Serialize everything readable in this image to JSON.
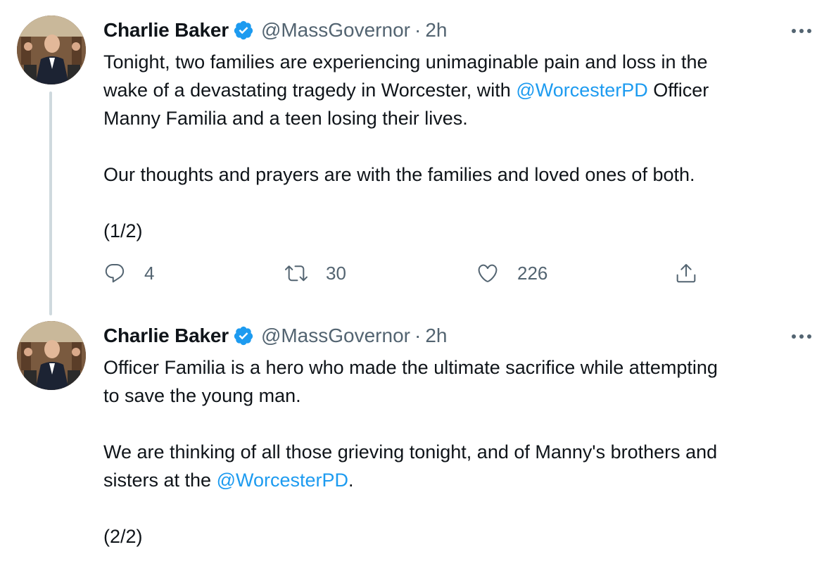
{
  "tweets": [
    {
      "author": {
        "name": "Charlie Baker",
        "handle": "@MassGovernor",
        "time": "2h",
        "separator": "·",
        "verified": true
      },
      "text": {
        "l1": "Tonight, two families are experiencing unimaginable pain and loss in the",
        "l2a": "wake of a devastating tragedy in Worcester, with ",
        "l2m": "@WorcesterPD",
        "l2b": " Officer",
        "l3": "Manny Familia and a teen losing their lives.",
        "l4": "Our thoughts and prayers are with the families and loved ones of both.",
        "l5": "(1/2)"
      },
      "actions": {
        "replies": "4",
        "retweets": "30",
        "likes": "226"
      }
    },
    {
      "author": {
        "name": "Charlie Baker",
        "handle": "@MassGovernor",
        "time": "2h",
        "separator": "·",
        "verified": true
      },
      "text": {
        "l1": "Officer Familia is a hero who made the ultimate sacrifice while attempting",
        "l2": "to save the young man.",
        "l3": "We are thinking of all those grieving tonight, and of Manny's brothers and",
        "l4a": "sisters at the ",
        "l4m": "@WorcesterPD",
        "l4b": ".",
        "l5": "(2/2)"
      }
    }
  ],
  "colors": {
    "link": "#1d9bf0",
    "secondary": "#536471",
    "verified": "#1d9bf0",
    "thread_line": "#cfd9de"
  },
  "icons": [
    "reply-icon",
    "retweet-icon",
    "like-icon",
    "share-icon",
    "more-icon",
    "verified-badge-icon"
  ]
}
